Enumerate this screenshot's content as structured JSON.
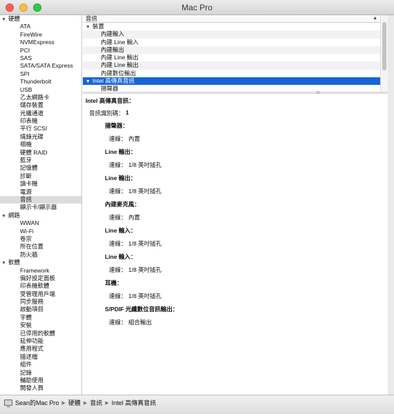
{
  "window": {
    "title": "Mac Pro"
  },
  "sidebar": {
    "groups": [
      {
        "label": "硬體",
        "items": [
          "ATA",
          "FireWire",
          "NVMExpress",
          "PCI",
          "SAS",
          "SATA/SATA Express",
          "SPI",
          "Thunderbolt",
          "USB",
          "乙太網路卡",
          "儲存裝置",
          "光纖通道",
          "印表機",
          "平行 SCSI",
          "燒錄光碟",
          "相機",
          "硬體 RAID",
          "藍牙",
          "記憶體",
          "診斷",
          "讀卡機",
          "電源",
          "音訊",
          "顯示卡/顯示器"
        ],
        "selected_index": 22
      },
      {
        "label": "網路",
        "items": [
          "WWAN",
          "Wi-Fi",
          "卷宗",
          "所在位置",
          "防火牆"
        ]
      },
      {
        "label": "軟體",
        "items": [
          "Framework",
          "偏好設定面板",
          "印表機軟體",
          "受管理用戶端",
          "同步服務",
          "啟動項目",
          "字體",
          "安裝",
          "已停用的軟體",
          "延伸功能",
          "應用程式",
          "描述檔",
          "組件",
          "記錄",
          "輔助使用",
          "開發人員"
        ]
      }
    ]
  },
  "list": {
    "column_header": "音訊",
    "groups": [
      {
        "label": "裝置",
        "items": [
          "內建輸入",
          "內建 Line 輸入",
          "內建輸出",
          "內建 Line 輸出",
          "內建 Line 輸出",
          "內建數位輸出"
        ]
      },
      {
        "label": "Intel 高傳真音訊",
        "items": [
          "揚聲器"
        ],
        "selected": true
      }
    ]
  },
  "detail": {
    "title": "Intel 高傳真音訊：",
    "id_label": "音訊識別碼：",
    "id_value": "1",
    "connection_label": "連線：",
    "devices": [
      {
        "name": "揚聲器：",
        "connection": "內置"
      },
      {
        "name": "Line 輸出：",
        "connection": "1/8 英吋插孔"
      },
      {
        "name": "Line 輸出：",
        "connection": "1/8 英吋插孔"
      },
      {
        "name": "內建麥克風：",
        "connection": "內置"
      },
      {
        "name": "Line 輸入：",
        "connection": "1/8 英吋插孔"
      },
      {
        "name": "Line 輸入：",
        "connection": "1/8 英吋插孔"
      },
      {
        "name": "耳機：",
        "connection": "1/8 英吋插孔"
      },
      {
        "name": "S/PDIF 光纖數位音訊輸出：",
        "connection": "組合輸出"
      }
    ]
  },
  "breadcrumb": [
    "Sean的Mac Pro",
    "硬體",
    "音訊",
    "Intel 高傳真音訊"
  ],
  "colors": {
    "selection": "#1766d6",
    "sidebar_selection": "#dcdcdc"
  },
  "icons": [
    "close-button",
    "minimize-button",
    "zoom-button",
    "disclosure-triangle-icon",
    "sort-arrow-icon",
    "computer-icon",
    "breadcrumb-separator-icon"
  ]
}
